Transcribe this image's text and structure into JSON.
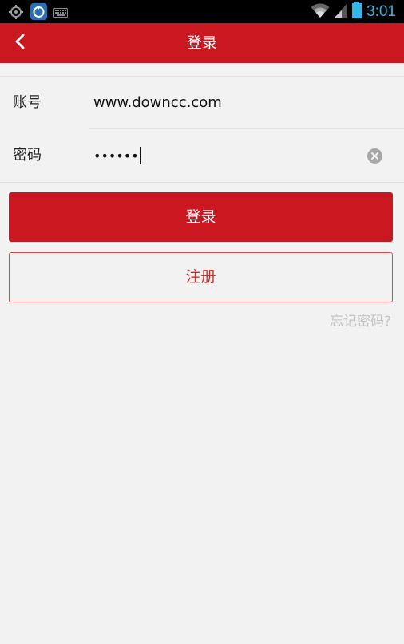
{
  "status_bar": {
    "time": "3:01",
    "icons": [
      "gps-icon",
      "app-notification-icon",
      "keyboard-icon",
      "wifi-icon",
      "signal-icon",
      "battery-icon"
    ],
    "accent_color": "#33b5e5"
  },
  "header": {
    "title": "登录",
    "back_icon": "chevron-left-icon",
    "background_color": "#cb1720"
  },
  "form": {
    "account": {
      "label": "账号",
      "value": "www.downcc.com"
    },
    "password": {
      "label": "密码",
      "masked_value": "••••••",
      "clear_icon": "clear-icon"
    }
  },
  "actions": {
    "login_label": "登录",
    "register_label": "注册",
    "forgot_label": "忘记密码?"
  }
}
